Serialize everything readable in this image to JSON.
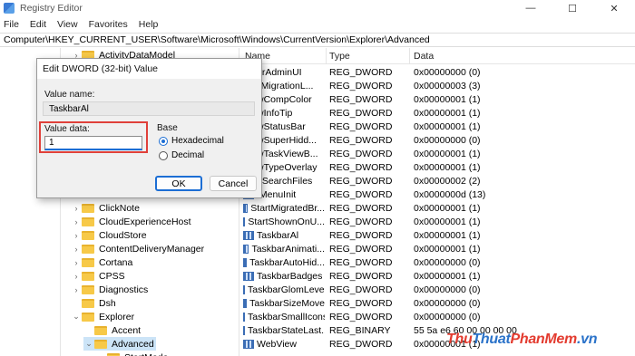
{
  "window": {
    "title": "Registry Editor",
    "controls": {
      "minimize": "—",
      "maximize": "☐",
      "close": "✕"
    }
  },
  "menu": [
    "File",
    "Edit",
    "View",
    "Favorites",
    "Help"
  ],
  "address": "Computer\\HKEY_CURRENT_USER\\Software\\Microsoft\\Windows\\CurrentVersion\\Explorer\\Advanced",
  "tree": {
    "items": [
      {
        "label": "ActivityDataModel",
        "chevron": "›",
        "indent": 1
      },
      {
        "label": "ClickNote",
        "chevron": "›",
        "indent": 1
      },
      {
        "label": "CloudExperienceHost",
        "chevron": "›",
        "indent": 1
      },
      {
        "label": "CloudStore",
        "chevron": "›",
        "indent": 1
      },
      {
        "label": "ContentDeliveryManager",
        "chevron": "›",
        "indent": 1
      },
      {
        "label": "Cortana",
        "chevron": "›",
        "indent": 1
      },
      {
        "label": "CPSS",
        "chevron": "›",
        "indent": 1
      },
      {
        "label": "Diagnostics",
        "chevron": "›",
        "indent": 1
      },
      {
        "label": "Dsh",
        "chevron": "",
        "indent": 1
      },
      {
        "label": "Explorer",
        "chevron": "⌄",
        "indent": 1
      },
      {
        "label": "Accent",
        "chevron": "",
        "indent": 2
      },
      {
        "label": "Advanced",
        "chevron": "⌄",
        "indent": 2,
        "selected": true
      },
      {
        "label": "StartMode",
        "chevron": "",
        "indent": 3
      }
    ]
  },
  "list": {
    "columns": [
      "Name",
      "Type",
      "Data"
    ],
    "rows": [
      {
        "name": "erAdminUI",
        "type": "REG_DWORD",
        "data": "0x00000000 (0)"
      },
      {
        "name": "llMigrationL...",
        "type": "REG_DWORD",
        "data": "0x00000003 (3)"
      },
      {
        "name": "wCompColor",
        "type": "REG_DWORD",
        "data": "0x00000001 (1)"
      },
      {
        "name": "wInfoTip",
        "type": "REG_DWORD",
        "data": "0x00000001 (1)"
      },
      {
        "name": "wStatusBar",
        "type": "REG_DWORD",
        "data": "0x00000001 (1)"
      },
      {
        "name": "wSuperHidd...",
        "type": "REG_DWORD",
        "data": "0x00000000 (0)"
      },
      {
        "name": "wTaskViewB...",
        "type": "REG_DWORD",
        "data": "0x00000001 (1)"
      },
      {
        "name": "wTypeOverlay",
        "type": "REG_DWORD",
        "data": "0x00000001 (1)"
      },
      {
        "name": "_SearchFiles",
        "type": "REG_DWORD",
        "data": "0x00000002 (2)"
      },
      {
        "name": "tMenuInit",
        "type": "REG_DWORD",
        "data": "0x0000000d (13)"
      },
      {
        "name": "StartMigratedBr...",
        "type": "REG_DWORD",
        "data": "0x00000001 (1)"
      },
      {
        "name": "StartShownOnU...",
        "type": "REG_DWORD",
        "data": "0x00000001 (1)"
      },
      {
        "name": "TaskbarAl",
        "type": "REG_DWORD",
        "data": "0x00000001 (1)"
      },
      {
        "name": "TaskbarAnimati...",
        "type": "REG_DWORD",
        "data": "0x00000001 (1)"
      },
      {
        "name": "TaskbarAutoHid...",
        "type": "REG_DWORD",
        "data": "0x00000000 (0)"
      },
      {
        "name": "TaskbarBadges",
        "type": "REG_DWORD",
        "data": "0x00000001 (1)"
      },
      {
        "name": "TaskbarGlomLevel",
        "type": "REG_DWORD",
        "data": "0x00000000 (0)"
      },
      {
        "name": "TaskbarSizeMove",
        "type": "REG_DWORD",
        "data": "0x00000000 (0)"
      },
      {
        "name": "TaskbarSmallIcons",
        "type": "REG_DWORD",
        "data": "0x00000000 (0)"
      },
      {
        "name": "TaskbarStateLast...",
        "type": "REG_BINARY",
        "data": "55 5a e6 60 00 00 00 00"
      },
      {
        "name": "WebView",
        "type": "REG_DWORD",
        "data": "0x00000001 (1)"
      }
    ]
  },
  "dialog": {
    "title": "Edit DWORD (32-bit) Value",
    "value_name_label": "Value name:",
    "value_name": "TaskbarAl",
    "value_data_label": "Value data:",
    "value_data": "1",
    "base_label": "Base",
    "hex_label": "Hexadecimal",
    "dec_label": "Decimal",
    "base_selected": "Hexadecimal",
    "ok_label": "OK",
    "cancel_label": "Cancel"
  },
  "watermark": {
    "part1": "Thu",
    "part2": "Thuat",
    "part3": "PhanMem",
    "part4": ".vn"
  },
  "colors": {
    "highlight": "#e0403a",
    "accent": "#1c6ed4",
    "selected_row": "#cce4f7"
  }
}
